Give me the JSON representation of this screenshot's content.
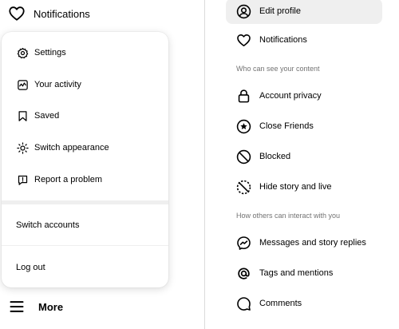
{
  "left_nav": {
    "notifications_label": "Notifications",
    "more_label": "More"
  },
  "more_menu": {
    "items": [
      {
        "label": "Settings",
        "icon": "gear-icon"
      },
      {
        "label": "Your activity",
        "icon": "activity-icon"
      },
      {
        "label": "Saved",
        "icon": "bookmark-icon"
      },
      {
        "label": "Switch appearance",
        "icon": "sun-icon"
      },
      {
        "label": "Report a problem",
        "icon": "report-icon"
      }
    ],
    "switch_accounts": "Switch accounts",
    "log_out": "Log out"
  },
  "settings_sidebar": {
    "items_top": [
      {
        "label": "Edit profile",
        "icon": "user-circle-icon",
        "active": true
      },
      {
        "label": "Notifications",
        "icon": "heart-icon"
      }
    ],
    "section_content": "Who can see your content",
    "items_content": [
      {
        "label": "Account privacy",
        "icon": "lock-icon"
      },
      {
        "label": "Close Friends",
        "icon": "star-circle-icon"
      },
      {
        "label": "Blocked",
        "icon": "blocked-icon"
      },
      {
        "label": "Hide story and live",
        "icon": "hide-story-icon"
      }
    ],
    "section_interact": "How others can interact with you",
    "items_interact": [
      {
        "label": "Messages and story replies",
        "icon": "messenger-icon"
      },
      {
        "label": "Tags and mentions",
        "icon": "at-icon"
      },
      {
        "label": "Comments",
        "icon": "comment-icon"
      }
    ]
  }
}
